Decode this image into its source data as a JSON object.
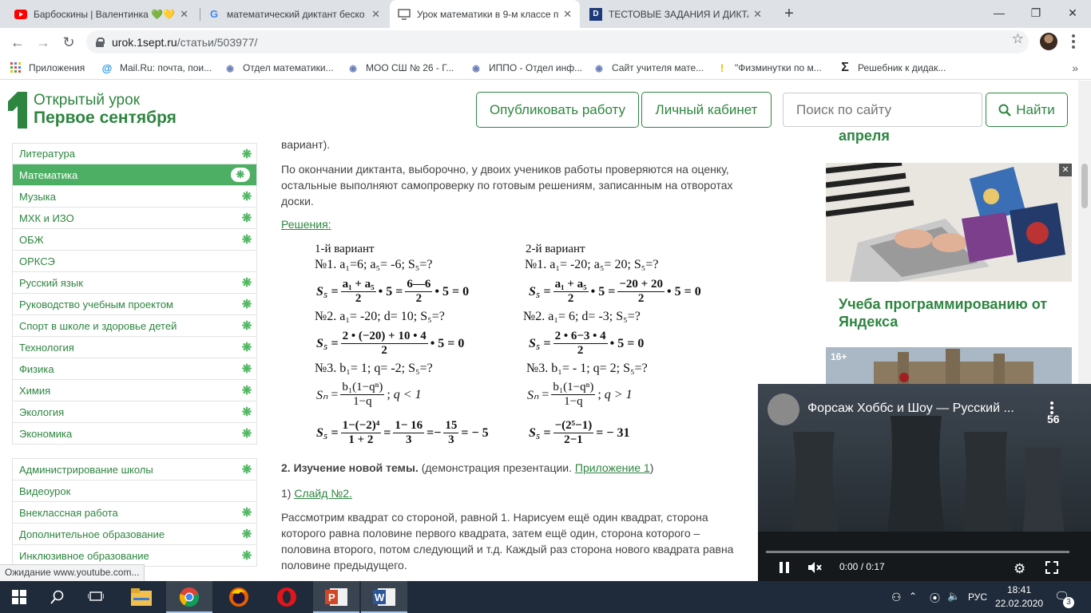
{
  "browser": {
    "tabs": [
      {
        "title": "Барбоскины | Валентинка 💚💛",
        "icon": "youtube-icon"
      },
      {
        "title": "математический диктант беско",
        "icon": "google-icon"
      },
      {
        "title": "Урок математики в 9-м классе п",
        "icon": "page-icon",
        "active": true
      },
      {
        "title": "ТЕСТОВЫЕ ЗАДАНИЯ И ДИКТАНТ",
        "icon": "d-icon"
      }
    ],
    "url_host": "urok.1sept.ru",
    "url_path": "/статьи/503977/",
    "bookmarks": [
      "Приложения",
      "Mail.Ru: почта, пои...",
      "Отдел математики...",
      "МОО СШ № 26 - Г...",
      "ИППО - Отдел инф...",
      "Сайт учителя мате...",
      "\"Физминутки по м...",
      "Решебник к дидак..."
    ],
    "bookmarks_more": "»",
    "status_text": "Ожидание www.youtube.com..."
  },
  "site": {
    "logo_top": "Открытый урок",
    "logo_bottom": "Первое сентября",
    "publish_button": "Опубликовать работу",
    "cabinet_button": "Личный кабинет",
    "search_placeholder": "Поиск по сайту",
    "search_button": "Найти",
    "accent_color": "#2e8540"
  },
  "sidebar": {
    "group1": [
      {
        "label": "Литература",
        "spark": true
      },
      {
        "label": "Математика",
        "spark": true,
        "active": true
      },
      {
        "label": "Музыка",
        "spark": true
      },
      {
        "label": "МХК и ИЗО",
        "spark": true
      },
      {
        "label": "ОБЖ",
        "spark": true
      },
      {
        "label": "ОРКСЭ",
        "spark": false
      },
      {
        "label": "Русский язык",
        "spark": true
      },
      {
        "label": "Руководство учебным проектом",
        "spark": true
      },
      {
        "label": "Спорт в школе и здоровье детей",
        "spark": true
      },
      {
        "label": "Технология",
        "spark": true
      },
      {
        "label": "Физика",
        "spark": true
      },
      {
        "label": "Химия",
        "spark": true
      },
      {
        "label": "Экология",
        "spark": true
      },
      {
        "label": "Экономика",
        "spark": true
      }
    ],
    "group2": [
      {
        "label": "Администрирование школы",
        "spark": true
      },
      {
        "label": "Видеоурок",
        "spark": false
      },
      {
        "label": "Внеклассная работа",
        "spark": true
      },
      {
        "label": "Дополнительное образование",
        "spark": true
      },
      {
        "label": "Инклюзивное образование",
        "spark": true
      }
    ]
  },
  "article": {
    "top_fragment": "вариант).",
    "para1": "По окончании диктанта, выборочно, у двоих учеников работы проверяются на оценку, остальные выполняют самопроверку по готовым решениям, записанным на отворотах доски.",
    "solutions_label": "Решения:",
    "v1_title": "1-й вариант",
    "v2_title": "2-й вариант",
    "v1_q1": "№1. a₁=6; a₅= -6; S₅=?",
    "v2_q1": "№1. a₁= -20; a₅= 20; S₅=?",
    "v1_q2": "№2.  a₁= -20; d= 10; S₅=?",
    "v2_q2": "№2.  a₁= 6; d= -3; S₅=?",
    "v1_q3": "№3.  b₁= 1; q= -2; S₅=?",
    "v2_q3": "№3.  b₁= - 1; q= 2; S₅=?",
    "f1_num": "a₁ + a₅",
    "f1_den": "2",
    "f1_num2": "6—6",
    "f1_den2": "2",
    "f1_tail": "• 5 = 0",
    "f2_num": "a₁ + a₅",
    "f2_den": "2",
    "f2_num2": "−20 + 20",
    "f2_den2": "2",
    "f2_tail": "• 5 = 0",
    "f3_num": "2 • (−20) + 10 • 4",
    "f3_den": "2",
    "f3_tail": "• 5 = 0",
    "f4_num": "2 • 6−3 • 4",
    "f4_den": "2",
    "f4_tail": "• 5 = 0",
    "f5_num": "b₁(1−qⁿ)",
    "f5_den": "1−q",
    "f5_cond": "q < 1",
    "f6_num": "b₁(1−qⁿ)",
    "f6_den": "1−q",
    "f6_cond": "q > 1",
    "f7_num": "1−(−2)⁴",
    "f7_den": "1 + 2",
    "f7_num2": "1− 16",
    "f7_den2": "3",
    "f7_num3": "15",
    "f7_den3": "3",
    "f7_tail": "= − 5",
    "f8_num": "−(2⁵−1)",
    "f8_den": "2−1",
    "f8_tail": "= − 31",
    "section2_bold": "2. Изучение новой темы.",
    "section2_text": "(демонстрация презентации.",
    "section2_link": "Приложение 1",
    "slide_prefix": "1)",
    "slide_link": "Слайд №2.",
    "para2": "Рассмотрим квадрат со стороной, равной 1. Нарисуем ещё один квадрат, сторона которого равна половине первого квадрата, затем ещё один, сторона которого – половина второго, потом следующий и т.д. Каждый раз сторона нового квадрата равна половине предыдущего."
  },
  "right_column": {
    "top_title_fragment": "апреля",
    "promo_title": "Учеба программированию от Яндекса",
    "age_badge": "16+"
  },
  "video": {
    "title": "Форсаж Хоббс и Шоу — Русский ...",
    "count": "56",
    "time": "0:00 / 0:17",
    "progress": 0.0
  },
  "taskbar": {
    "time": "18:41",
    "date": "22.02.2020",
    "lang": "РУС",
    "notifications": "3"
  }
}
